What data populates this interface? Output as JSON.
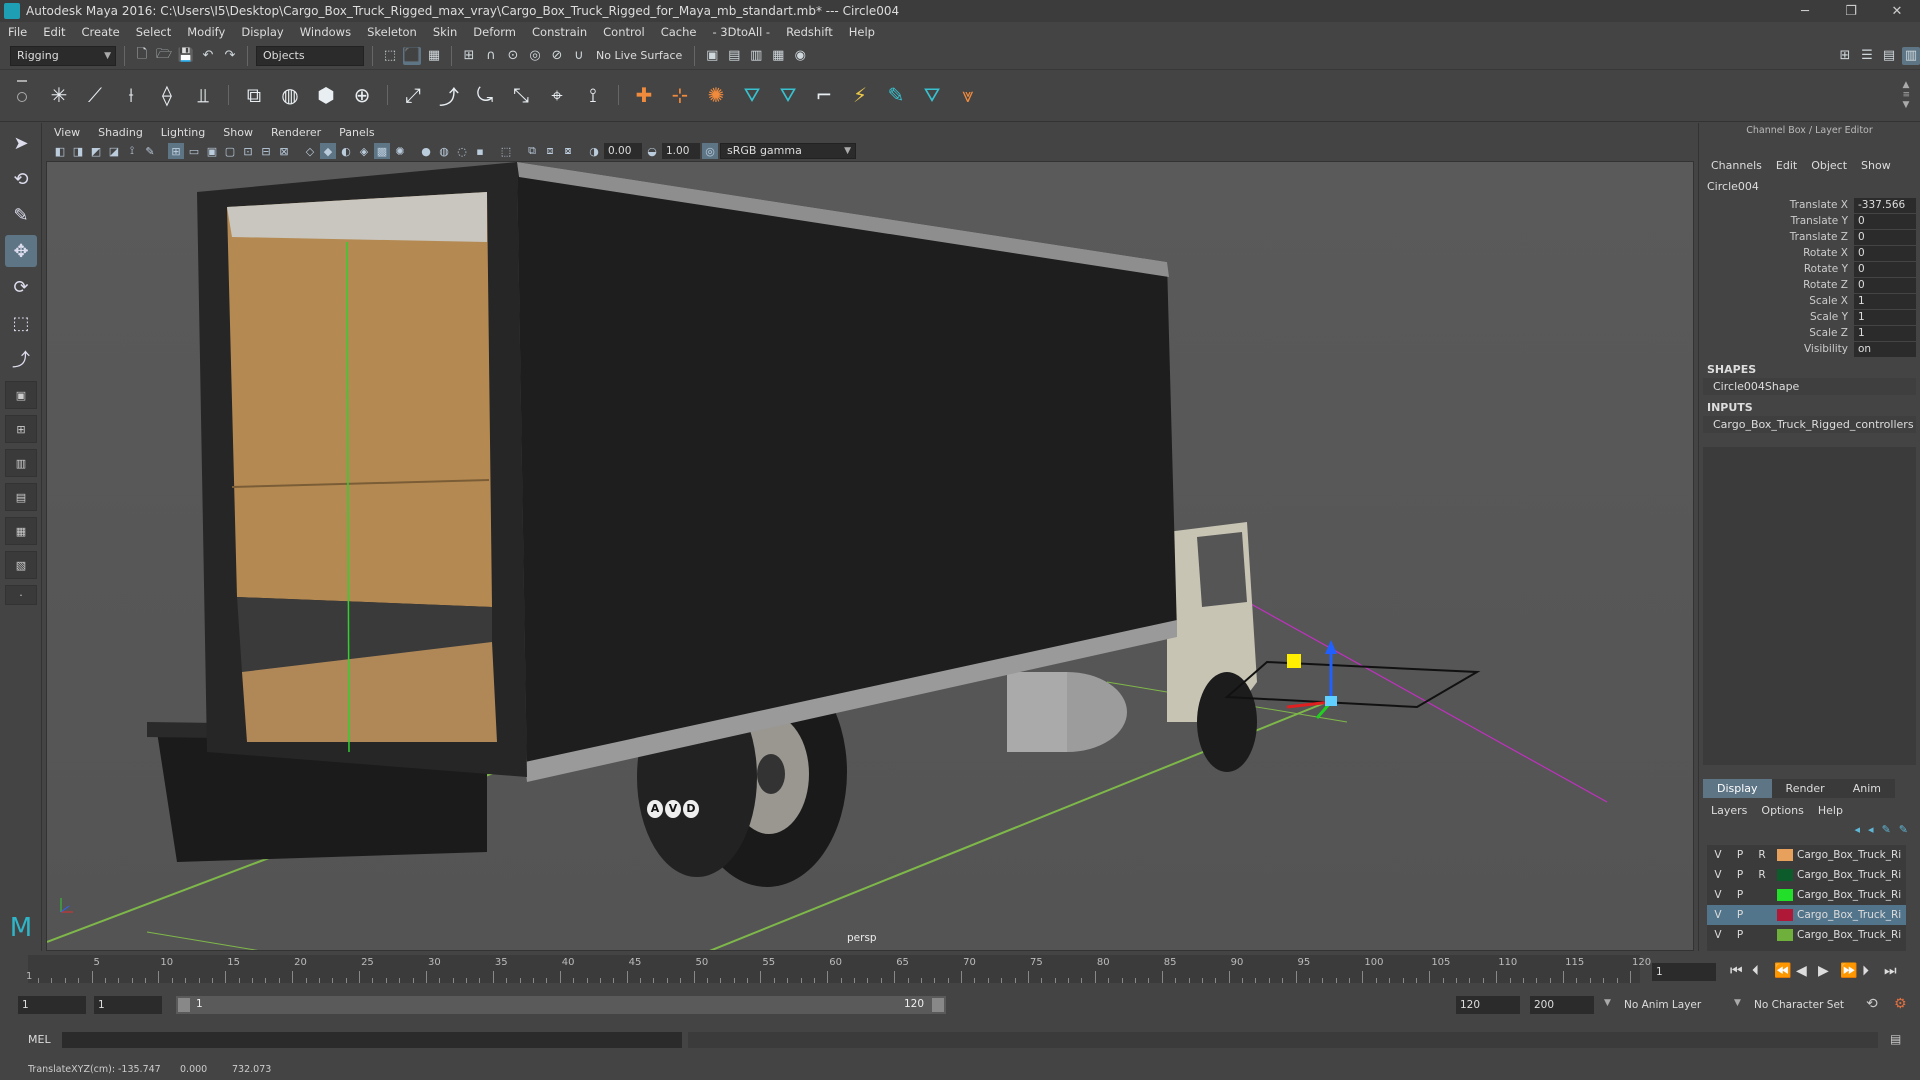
{
  "window": {
    "title": "Autodesk Maya 2016: C:\\Users\\I5\\Desktop\\Cargo_Box_Truck_Rigged_max_vray\\Cargo_Box_Truck_Rigged_for_Maya_mb_standart.mb*  ---  Circle004",
    "minimize": "─",
    "maximize": "❐",
    "close": "✕"
  },
  "menubar": [
    "File",
    "Edit",
    "Create",
    "Select",
    "Modify",
    "Display",
    "Windows",
    "Skeleton",
    "Skin",
    "Deform",
    "Constrain",
    "Control",
    "Cache",
    "- 3DtoAll -",
    "Redshift",
    "Help"
  ],
  "statusline": {
    "menuset": "Rigging",
    "selection_mode": "Objects",
    "live_surface": "No Live Surface"
  },
  "viewport": {
    "menu": [
      "View",
      "Shading",
      "Lighting",
      "Show",
      "Renderer",
      "Panels"
    ],
    "near_value": "0.00",
    "far_value": "1.00",
    "color_space": "sRGB gamma",
    "camera_label": "persp",
    "truck_marks": [
      "A",
      "V",
      "D"
    ]
  },
  "channel_box": {
    "title": "Channel Box / Layer Editor",
    "menu": [
      "Channels",
      "Edit",
      "Object",
      "Show"
    ],
    "node": "Circle004",
    "attributes": [
      {
        "name": "Translate X",
        "value": "-337.566"
      },
      {
        "name": "Translate Y",
        "value": "0"
      },
      {
        "name": "Translate Z",
        "value": "0"
      },
      {
        "name": "Rotate X",
        "value": "0"
      },
      {
        "name": "Rotate Y",
        "value": "0"
      },
      {
        "name": "Rotate Z",
        "value": "0"
      },
      {
        "name": "Scale X",
        "value": "1"
      },
      {
        "name": "Scale Y",
        "value": "1"
      },
      {
        "name": "Scale Z",
        "value": "1"
      },
      {
        "name": "Visibility",
        "value": "on"
      }
    ],
    "shapes_label": "SHAPES",
    "shape": "Circle004Shape",
    "inputs_label": "INPUTS",
    "input": "Cargo_Box_Truck_Rigged_controllers"
  },
  "layer_editor": {
    "tabs": [
      "Display",
      "Render",
      "Anim"
    ],
    "menu": [
      "Layers",
      "Options",
      "Help"
    ],
    "layers": [
      {
        "v": "V",
        "p": "P",
        "r": "R",
        "color": "#e8a15c",
        "name": "Cargo_Box_Truck_Ri",
        "selected": false
      },
      {
        "v": "V",
        "p": "P",
        "r": "R",
        "color": "#0d5a2a",
        "name": "Cargo_Box_Truck_Ri",
        "selected": false
      },
      {
        "v": "V",
        "p": "P",
        "r": "",
        "color": "#22e02a",
        "name": "Cargo_Box_Truck_Ri",
        "selected": false
      },
      {
        "v": "V",
        "p": "P",
        "r": "",
        "color": "#b01838",
        "name": "Cargo_Box_Truck_Ri",
        "selected": true
      },
      {
        "v": "V",
        "p": "P",
        "r": "",
        "color": "#6fb03c",
        "name": "Cargo_Box_Truck_Ri",
        "selected": false
      }
    ]
  },
  "timeslider": {
    "ticks": [
      "5",
      "10",
      "15",
      "20",
      "25",
      "30",
      "35",
      "40",
      "45",
      "50",
      "55",
      "60",
      "65",
      "70",
      "75",
      "80",
      "85",
      "90",
      "95",
      "100",
      "105",
      "110",
      "115",
      "120"
    ],
    "start_label": "1",
    "current_frame": "1"
  },
  "range": {
    "start": "1",
    "inner_start": "1",
    "slider_start": "1",
    "slider_end": "120",
    "end": "120",
    "max": "200",
    "anim_layer": "No Anim Layer",
    "character_set": "No Character Set"
  },
  "commandline": {
    "label": "MEL"
  },
  "helpline": {
    "label": "TranslateXYZ(cm):",
    "x": "-135.747",
    "y": "0.000",
    "z": "732.073"
  }
}
